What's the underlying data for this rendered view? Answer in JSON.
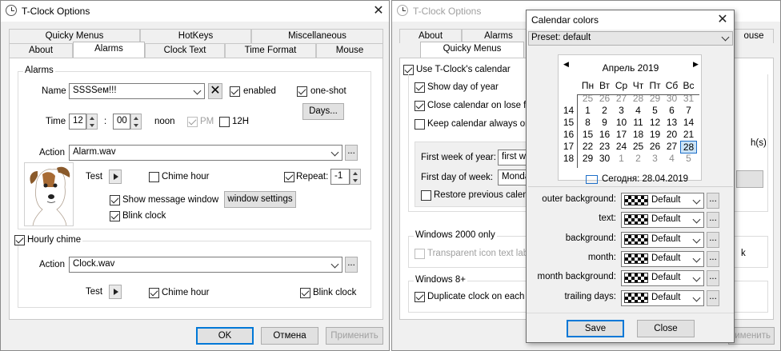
{
  "left_window": {
    "title": "T-Clock Options",
    "tabs_back": [
      "Quicky Menus",
      "HotKeys",
      "Miscellaneous"
    ],
    "tabs_front": [
      "About",
      "Alarms",
      "Clock Text",
      "Time Format",
      "Mouse"
    ],
    "alarms": {
      "group_label": "Alarms",
      "name_label": "Name",
      "name_value": "SSSSем!!!",
      "enabled_label": "enabled",
      "oneshot_label": "one-shot",
      "days_button": "Days...",
      "time_label": "Time",
      "hour": "12",
      "colon": ":",
      "minute": "00",
      "noon_label": "noon",
      "pm_label": "PM",
      "h12_label": "12H",
      "action_label": "Action",
      "action_value": "Alarm.wav",
      "browse": "...",
      "test_label": "Test",
      "chime_hour_label": "Chime hour",
      "repeat_label": "Repeat:",
      "repeat_value": "-1",
      "show_message_label": "Show message window",
      "window_settings_button": "window settings",
      "blink_clock_label": "Blink clock"
    },
    "hourly": {
      "group_label": "Hourly chime",
      "action_label": "Action",
      "action_value": "Clock.wav",
      "browse": "...",
      "test_label": "Test",
      "chime_hour_label": "Chime hour",
      "blink_clock_label": "Blink clock"
    },
    "buttons": {
      "ok": "OK",
      "cancel": "Отмена",
      "apply": "Применить"
    }
  },
  "right_window": {
    "title": "T-Clock Options",
    "tabs_back": [
      "About",
      "Alarms",
      "ouse"
    ],
    "tabs_front": [
      "Quicky Menus"
    ],
    "use_calendar_label": "Use T-Clock's calendar",
    "show_day_label": "Show day of year",
    "close_calendar_label": "Close calendar on lose foc",
    "keep_calendar_label": "Keep calendar always on t",
    "first_week_label": "First week of year:",
    "first_week_value": "first we",
    "first_day_label": "First day of week:",
    "first_day_value": "Monday",
    "restore_label": "Restore previous calenda",
    "win2000_group": "Windows 2000 only",
    "transparent_label": "Transparent icon text labe",
    "win8_group": "Windows 8+",
    "duplicate_label": "Duplicate clock on each ad",
    "partial_h": "h(s)",
    "partial_k": "k",
    "apply_partial": "именить"
  },
  "calendar_dialog": {
    "title": "Calendar colors",
    "preset": "Preset: default",
    "month_title": "Апрель 2019",
    "weekdays": [
      "Пн",
      "Вт",
      "Ср",
      "Чт",
      "Пт",
      "Сб",
      "Вс"
    ],
    "weeks": [
      {
        "num": "",
        "days": [
          [
            "25",
            true
          ],
          [
            "26",
            true
          ],
          [
            "27",
            true
          ],
          [
            "28",
            true
          ],
          [
            "29",
            true
          ],
          [
            "30",
            true
          ],
          [
            "31",
            true
          ]
        ]
      },
      {
        "num": "14",
        "days": [
          [
            "1",
            false
          ],
          [
            "2",
            false
          ],
          [
            "3",
            false
          ],
          [
            "4",
            false
          ],
          [
            "5",
            false
          ],
          [
            "6",
            false
          ],
          [
            "7",
            false
          ]
        ]
      },
      {
        "num": "15",
        "days": [
          [
            "8",
            false
          ],
          [
            "9",
            false
          ],
          [
            "10",
            false
          ],
          [
            "11",
            false
          ],
          [
            "12",
            false
          ],
          [
            "13",
            false
          ],
          [
            "14",
            false
          ]
        ]
      },
      {
        "num": "16",
        "days": [
          [
            "15",
            false
          ],
          [
            "16",
            false
          ],
          [
            "17",
            false
          ],
          [
            "18",
            false
          ],
          [
            "19",
            false
          ],
          [
            "20",
            false
          ],
          [
            "21",
            false
          ]
        ]
      },
      {
        "num": "17",
        "days": [
          [
            "22",
            false
          ],
          [
            "23",
            false
          ],
          [
            "24",
            false
          ],
          [
            "25",
            false
          ],
          [
            "26",
            false
          ],
          [
            "27",
            false
          ],
          [
            "28",
            false
          ]
        ]
      },
      {
        "num": "18",
        "days": [
          [
            "29",
            false
          ],
          [
            "30",
            false
          ],
          [
            "1",
            true
          ],
          [
            "2",
            true
          ],
          [
            "3",
            true
          ],
          [
            "4",
            true
          ],
          [
            "5",
            true
          ]
        ]
      }
    ],
    "today_text": "Сегодня: 28.04.2019",
    "color_rows": [
      {
        "label": "outer background:",
        "value": "Default"
      },
      {
        "label": "text:",
        "value": "Default"
      },
      {
        "label": "background:",
        "value": "Default"
      },
      {
        "label": "month:",
        "value": "Default"
      },
      {
        "label": "month background:",
        "value": "Default"
      },
      {
        "label": "trailing days:",
        "value": "Default"
      }
    ],
    "browse": "...",
    "save": "Save",
    "close": "Close"
  }
}
